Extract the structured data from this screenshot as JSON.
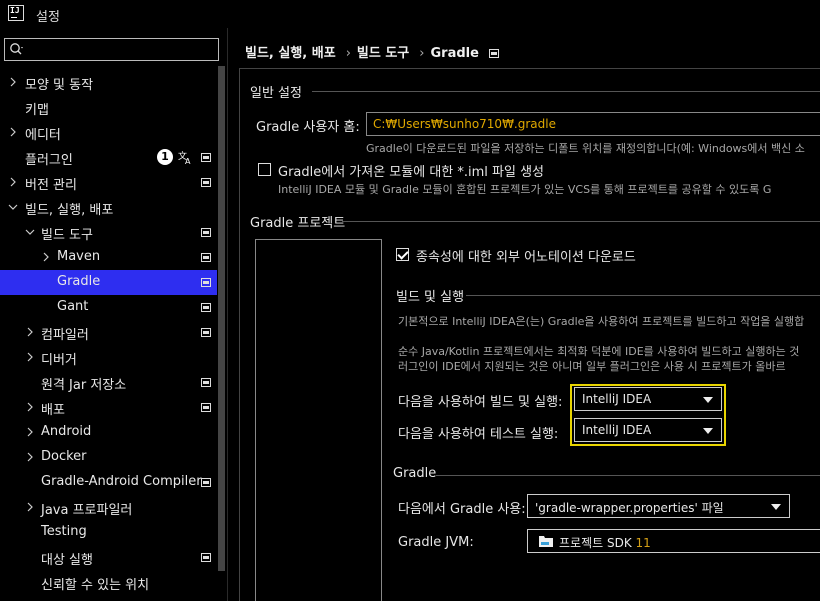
{
  "window": {
    "title": "설정",
    "app_icon_text": "IJ"
  },
  "search": {
    "placeholder": ""
  },
  "sidebar": {
    "items": [
      {
        "label": "모양 및 동작"
      },
      {
        "label": "키맵"
      },
      {
        "label": "에디터"
      },
      {
        "label": "플러그인",
        "badge": "1"
      },
      {
        "label": "버전 관리"
      },
      {
        "label": "빌드, 실행, 배포"
      },
      {
        "label": "빌드 도구"
      },
      {
        "label": "Maven"
      },
      {
        "label": "Gradle"
      },
      {
        "label": "Gant"
      },
      {
        "label": "컴파일러"
      },
      {
        "label": "디버거"
      },
      {
        "label": "원격 Jar 저장소"
      },
      {
        "label": "배포"
      },
      {
        "label": "Android"
      },
      {
        "label": "Docker"
      },
      {
        "label": "Gradle-Android Compiler"
      },
      {
        "label": "Java 프로파일러"
      },
      {
        "label": "Testing"
      },
      {
        "label": "대상 실행"
      },
      {
        "label": "신뢰할 수 있는 위치"
      }
    ],
    "selected": "Gradle"
  },
  "breadcrumb": {
    "items": [
      "빌드, 실행, 배포",
      "빌드 도구",
      "Gradle"
    ]
  },
  "general": {
    "title": "일반 설정",
    "gradle_home_label": "Gradle 사용자 홈:",
    "gradle_home_value": "C:₩Users₩sunho710₩.gradle",
    "gradle_home_hint": "Gradle이 다운로드된 파일을 저장하는 디폴트 위치를 재정의합니다(예: Windows에서 백신 소",
    "iml_checkbox_label": "Gradle에서 가져온 모듈에 대한 *.iml 파일 생성",
    "iml_checkbox_checked": false,
    "iml_hint": "IntelliJ IDEA 모듈 및 Gradle 모듈이 혼합된 프로젝트가 있는 VCS를 통해 프로젝트를 공유할 수 있도록 G"
  },
  "projects": {
    "title": "Gradle 프로젝트",
    "download_annotations_label": "종속성에 대한 외부 어노테이션 다운로드",
    "download_annotations_checked": true,
    "build_run": {
      "title": "빌드 및 실행",
      "hint1": "기본적으로 IntelliJ IDEA은(는) Gradle을 사용하여 프로젝트를 빌드하고 작업을 실행합",
      "hint2": "순수 Java/Kotlin 프로젝트에서는 최적화 덕분에 IDE를 사용하여 빌드하고 실행하는 것",
      "hint3": "러그인이 IDE에서 지원되는 것은 아니며 일부 플러그인은 사용 시 프로젝트가 올바르",
      "build_with_label": "다음을 사용하여 빌드 및 실행:",
      "build_with_value": "IntelliJ IDEA",
      "test_with_label": "다음을 사용하여 테스트 실행:",
      "test_with_value": "IntelliJ IDEA"
    },
    "gradle": {
      "title": "Gradle",
      "use_gradle_from_label": "다음에서 Gradle 사용:",
      "use_gradle_from_value": "'gradle-wrapper.properties' 파일",
      "jvm_label": "Gradle JVM:",
      "jvm_value_text": "프로젝트 SDK",
      "jvm_value_version": "11"
    }
  },
  "colors": {
    "selection": "#2e2ef0",
    "highlight": "#e8d400",
    "path_text": "#e0a800",
    "version_text": "#d4a017"
  }
}
